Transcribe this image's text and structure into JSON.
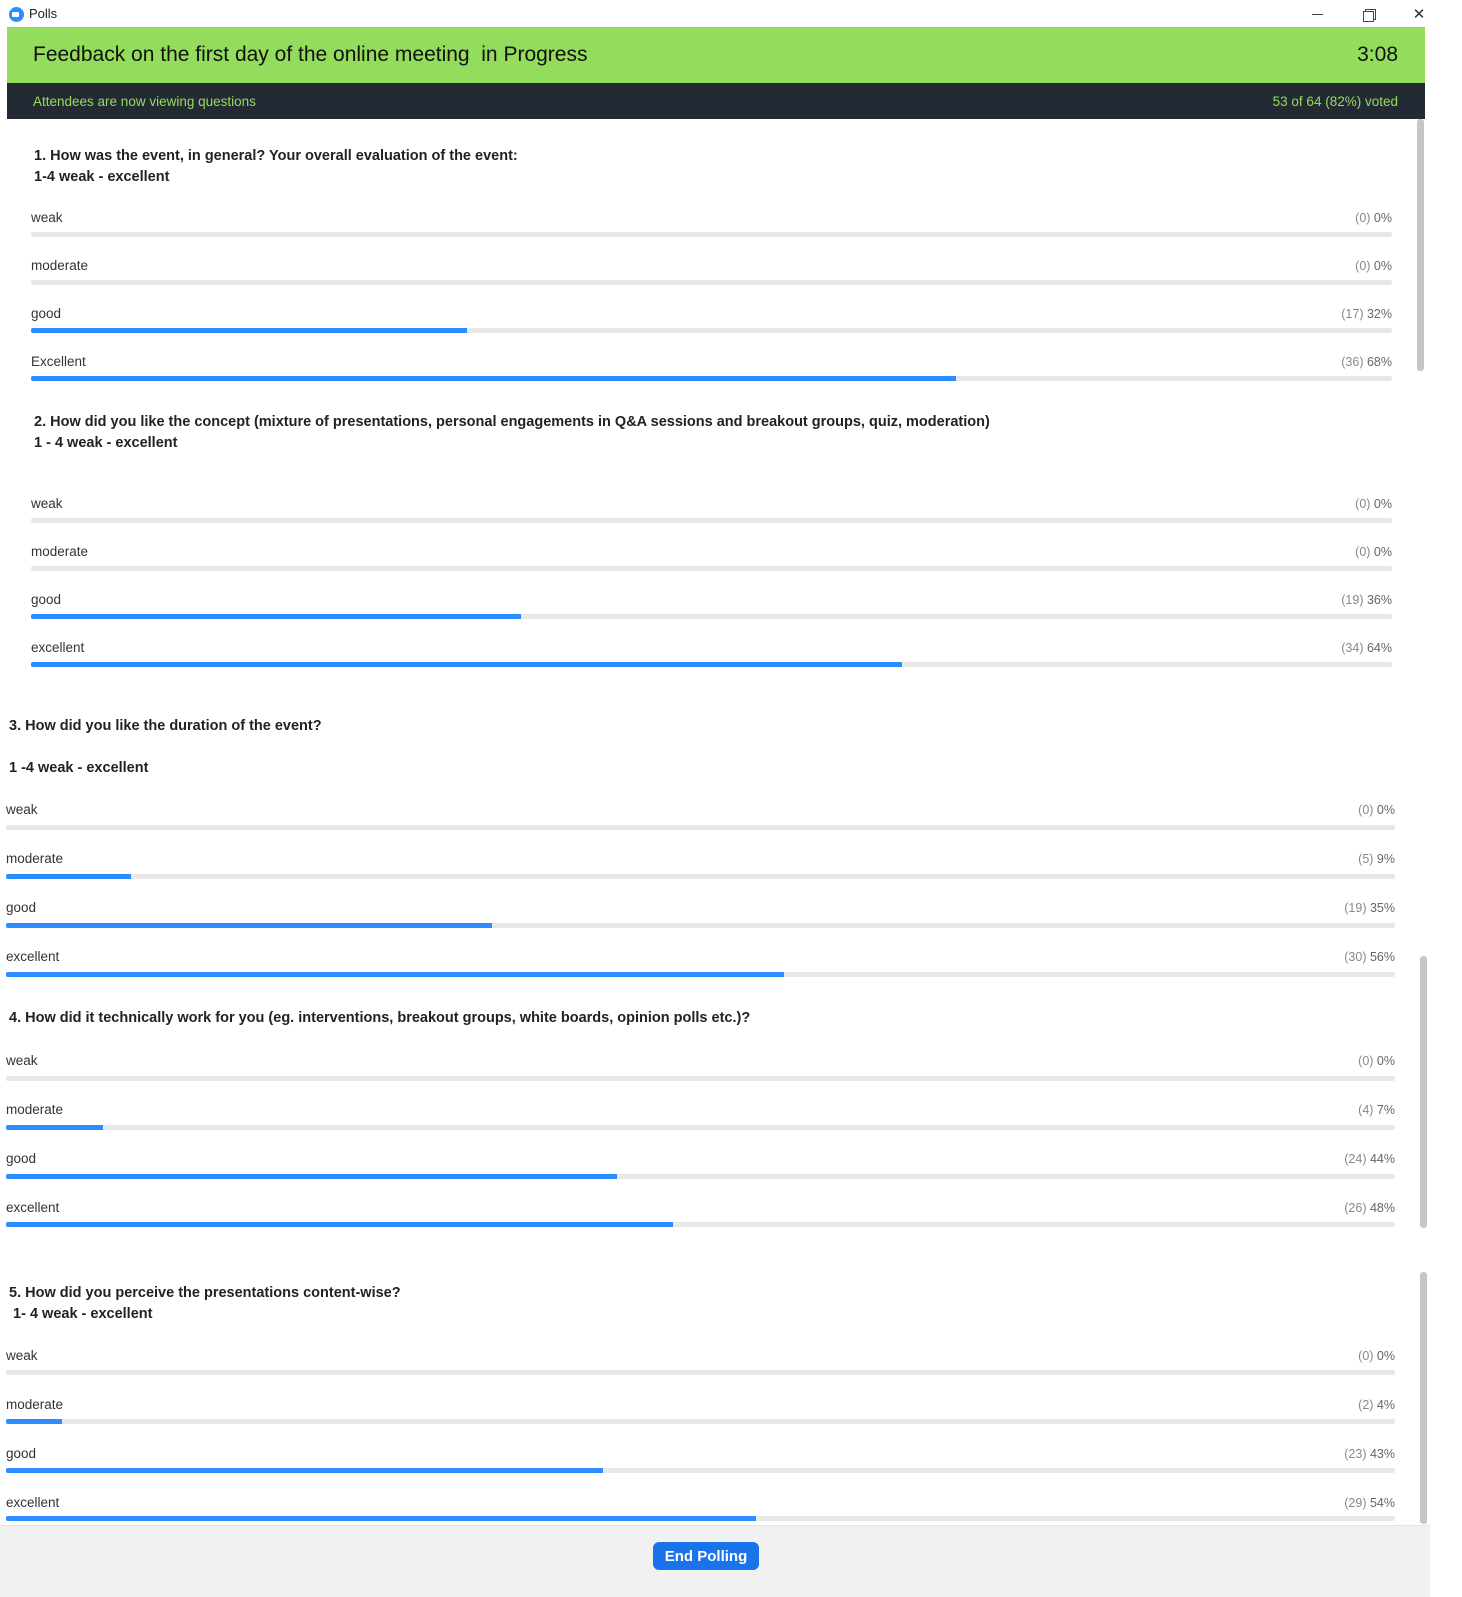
{
  "window": {
    "title": "Polls"
  },
  "banner": {
    "title": "Feedback on the first day of the online meeting  in Progress",
    "time": "3:08"
  },
  "status": {
    "left": "Attendees are now viewing questions",
    "right": "53 of 64 (82%) voted"
  },
  "questions": [
    {
      "line1": "1. How was the event, in general? Your overall evaluation of the event:",
      "line2": "1-4 weak - excellent",
      "options": [
        {
          "label": "weak",
          "count": "(0)",
          "percent": "0%",
          "fraction": 0
        },
        {
          "label": "moderate",
          "count": "(0)",
          "percent": "0%",
          "fraction": 0
        },
        {
          "label": "good",
          "count": "(17)",
          "percent": "32%",
          "fraction": 0.32
        },
        {
          "label": "Excellent",
          "count": "(36)",
          "percent": "68%",
          "fraction": 0.68
        }
      ]
    },
    {
      "line1": "2. How did you like the concept (mixture of presentations, personal engagements in Q&A sessions and breakout groups, quiz, moderation)",
      "line2": "1 - 4 weak - excellent",
      "options": [
        {
          "label": "weak",
          "count": "(0)",
          "percent": "0%",
          "fraction": 0
        },
        {
          "label": "moderate",
          "count": "(0)",
          "percent": "0%",
          "fraction": 0
        },
        {
          "label": "good",
          "count": "(19)",
          "percent": "36%",
          "fraction": 0.36
        },
        {
          "label": "excellent",
          "count": "(34)",
          "percent": "64%",
          "fraction": 0.64
        }
      ]
    },
    {
      "line1": "3. How did you like the duration of the event?",
      "line2": "1 -4 weak - excellent",
      "options": [
        {
          "label": "weak",
          "count": "(0)",
          "percent": "0%",
          "fraction": 0
        },
        {
          "label": "moderate",
          "count": "(5)",
          "percent": "9%",
          "fraction": 0.09
        },
        {
          "label": "good",
          "count": "(19)",
          "percent": "35%",
          "fraction": 0.35
        },
        {
          "label": "excellent",
          "count": "(30)",
          "percent": "56%",
          "fraction": 0.56
        }
      ]
    },
    {
      "line1": "4. How did it technically work for you (eg. interventions, breakout groups, white boards, opinion polls etc.)?",
      "line2": "",
      "options": [
        {
          "label": "weak",
          "count": "(0)",
          "percent": "0%",
          "fraction": 0
        },
        {
          "label": "moderate",
          "count": "(4)",
          "percent": "7%",
          "fraction": 0.07
        },
        {
          "label": "good",
          "count": "(24)",
          "percent": "44%",
          "fraction": 0.44
        },
        {
          "label": "excellent",
          "count": "(26)",
          "percent": "48%",
          "fraction": 0.48
        }
      ]
    },
    {
      "line1": "5. How did you perceive the presentations content-wise?",
      "line2": " 1- 4 weak - excellent",
      "options": [
        {
          "label": "weak",
          "count": "(0)",
          "percent": "0%",
          "fraction": 0
        },
        {
          "label": "moderate",
          "count": "(2)",
          "percent": "4%",
          "fraction": 0.04
        },
        {
          "label": "good",
          "count": "(23)",
          "percent": "43%",
          "fraction": 0.43
        },
        {
          "label": "excellent",
          "count": "(29)",
          "percent": "54%",
          "fraction": 0.54
        }
      ]
    }
  ],
  "footer": {
    "end_button": "End Polling"
  },
  "colors": {
    "banner": "#93dc5c",
    "status_bg": "#242a33",
    "bar_fill": "#2d8cff",
    "button": "#1a73e8"
  }
}
